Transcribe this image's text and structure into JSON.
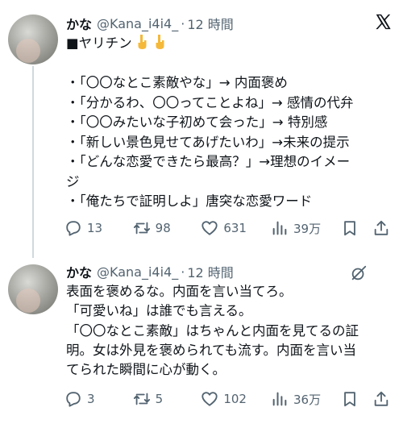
{
  "tweets": [
    {
      "author": "かな",
      "handle": "@Kana_i4i4_",
      "dot": "·",
      "time": "12 時間",
      "lines": [
        "■ヤリチン",
        "",
        "・「〇〇なとこ素敵やな」→ 内面褒め",
        "・「分かるわ、〇〇ってことよね」→ 感情の代弁",
        "・「〇〇みたいな子初めて会った」→ 特別感",
        "・「新しい景色見せてあげたいわ」→未来の提示",
        "・「どんな恋愛できたら最高？」→理想のイメー",
        "ジ",
        "・「俺たちで証明しよ」唐突な恋愛ワード"
      ],
      "emoji": [
        "pointing-down-hand",
        "pointing-down-hand"
      ],
      "corner_icon": "x-logo-icon",
      "stats": {
        "replies": "13",
        "reposts": "98",
        "likes": "631",
        "views": "39万"
      }
    },
    {
      "author": "かな",
      "handle": "@Kana_i4i4_",
      "dot": "·",
      "time": "12 時間",
      "lines": [
        "表面を褒めるな。内面を言い当てろ。",
        "「可愛いね」は誰でも言える。",
        "「〇〇なとこ素敵」はちゃんと内面を見てるの証",
        "明。女は外見を褒められても流す。内面を言い当",
        "てられた瞬間に心が動く。"
      ],
      "corner_icon": "grok-icon",
      "stats": {
        "replies": "3",
        "reposts": "5",
        "likes": "102",
        "views": "36万"
      }
    }
  ],
  "colors": {
    "text": "#0f1419",
    "muted": "#536471",
    "thread": "#cfd9de",
    "emoji": "#f5b93a"
  }
}
